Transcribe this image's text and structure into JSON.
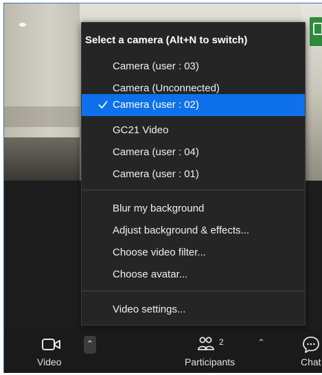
{
  "camera_menu": {
    "header": "Select a camera (Alt+N to switch)",
    "cameras": [
      {
        "label": "Camera (user : 03)",
        "selected": false
      },
      {
        "label": "Camera (Unconnected)",
        "selected": false
      },
      {
        "label": "Camera (user : 02)",
        "selected": true
      },
      {
        "label": "GC21 Video",
        "selected": false
      },
      {
        "label": "Camera (user : 04)",
        "selected": false
      },
      {
        "label": "Camera (user : 01)",
        "selected": false
      }
    ],
    "background_options": [
      {
        "label": "Blur my background"
      },
      {
        "label": "Adjust background & effects..."
      },
      {
        "label": "Choose video filter..."
      },
      {
        "label": "Choose avatar..."
      }
    ],
    "settings": {
      "label": "Video settings..."
    },
    "selected_icon": "checkmark-icon",
    "selected_color": "#0e71eb"
  },
  "toolbar": {
    "video": {
      "label": "Video",
      "icon": "video-camera-icon"
    },
    "participants": {
      "label": "Participants",
      "icon": "participants-icon",
      "count": "2"
    },
    "chat": {
      "label": "Chat",
      "icon": "chat-icon"
    }
  },
  "colors": {
    "accent": "#0e71eb",
    "toolbar_bg": "#1a1a1a",
    "menu_bg": "#252525"
  }
}
